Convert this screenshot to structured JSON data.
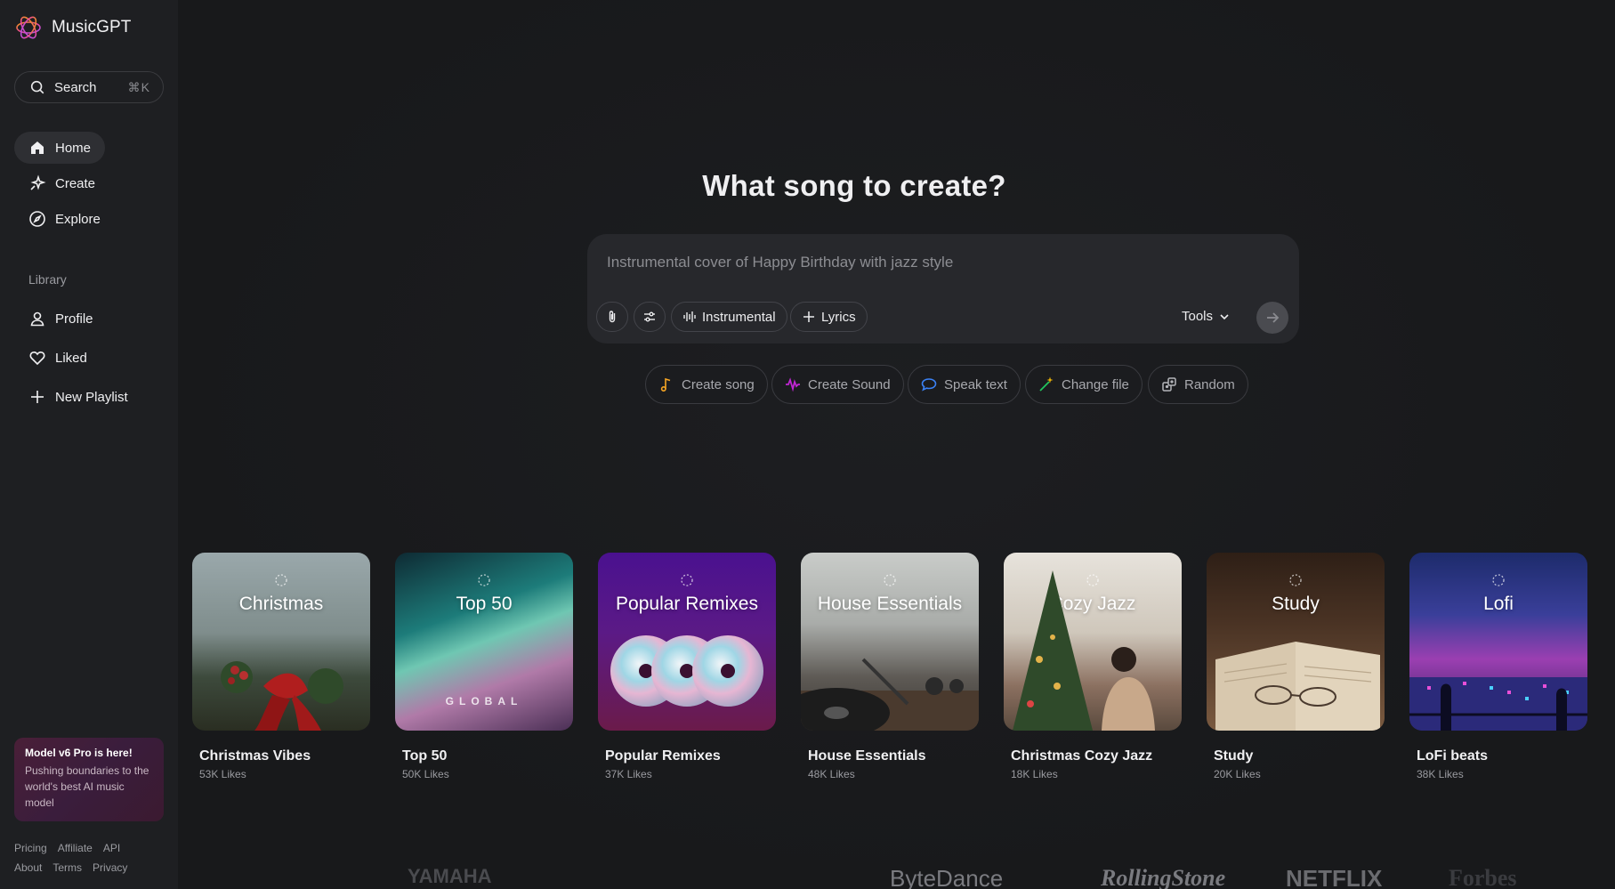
{
  "app": {
    "brand": "MusicGPT"
  },
  "sidebar": {
    "search_label": "Search",
    "search_shortcut": "⌘K",
    "nav": [
      {
        "label": "Home",
        "icon": "home-icon",
        "active": true
      },
      {
        "label": "Create",
        "icon": "sparkle-icon",
        "active": false
      },
      {
        "label": "Explore",
        "icon": "compass-icon",
        "active": false
      }
    ],
    "library_title": "Library",
    "library": [
      {
        "label": "Profile",
        "icon": "user-icon"
      },
      {
        "label": "Liked",
        "icon": "heart-icon"
      },
      {
        "label": "New Playlist",
        "icon": "plus-icon"
      }
    ],
    "promo": {
      "title": "Model v6 Pro is here!",
      "text": "Pushing boundaries to the world's best AI music model"
    },
    "footer": [
      "Pricing",
      "Affiliate",
      "API",
      "About",
      "Terms",
      "Privacy"
    ]
  },
  "main": {
    "headline": "What song to create?",
    "prompt_placeholder": "Instrumental cover of Happy Birthday with jazz style",
    "chips": {
      "instrumental": "Instrumental",
      "lyrics": "Lyrics"
    },
    "tools_label": "Tools",
    "quick_actions": [
      {
        "label": "Create song",
        "icon": "music-note-icon",
        "color": "#f5a524"
      },
      {
        "label": "Create Sound",
        "icon": "waveform-icon",
        "color": "#c026d3"
      },
      {
        "label": "Speak text",
        "icon": "speech-bubble-icon",
        "color": "#3b82f6"
      },
      {
        "label": "Change file",
        "icon": "magic-wand-icon",
        "color": "#22c55e"
      },
      {
        "label": "Random",
        "icon": "dice-icon",
        "color": "#9ca3af"
      }
    ]
  },
  "playlists": [
    {
      "cover_title": "Christmas",
      "name": "Christmas Vibes",
      "likes": "53K Likes"
    },
    {
      "cover_title": "Top 50",
      "cover_subtitle": "GLOBAL",
      "name": "Top 50",
      "likes": "50K Likes"
    },
    {
      "cover_title": "Popular Remixes",
      "name": "Popular Remixes",
      "likes": "37K Likes"
    },
    {
      "cover_title": "House Essentials",
      "name": "House Essentials",
      "likes": "48K Likes"
    },
    {
      "cover_title": "Cozy Jazz",
      "name": "Christmas Cozy Jazz",
      "likes": "18K Likes"
    },
    {
      "cover_title": "Study",
      "name": "Study",
      "likes": "20K Likes"
    },
    {
      "cover_title": "Lofi",
      "name": "LoFi beats",
      "likes": "38K Likes"
    }
  ],
  "partner_logos": [
    "YAMAHA",
    "ByteDance",
    "RollingStone",
    "NETFLIX",
    "Forbes"
  ],
  "colors": {
    "accent": "#f472b6",
    "background": "#18191b",
    "sidebar": "#1e1f22"
  }
}
